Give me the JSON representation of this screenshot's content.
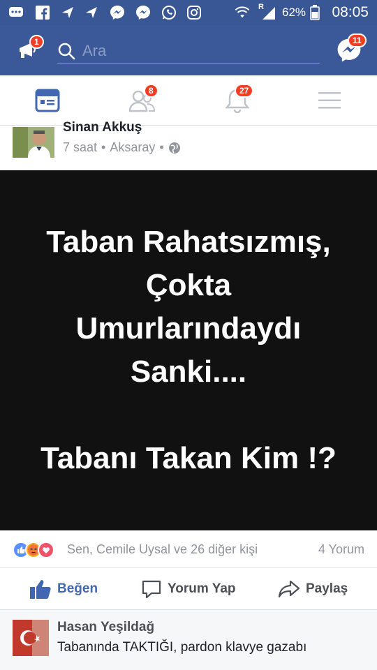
{
  "status_bar": {
    "battery": "62%",
    "time": "08:05",
    "signal_label": "R"
  },
  "header": {
    "notifications_badge": "1",
    "search_placeholder": "Ara",
    "messenger_badge": "11"
  },
  "tabs": {
    "friends_badge": "8",
    "notifications_badge": "27"
  },
  "post": {
    "author": "Sinan Akkuş",
    "time": "7 saat",
    "location": "Aksaray",
    "image_lines": [
      "Taban Rahatsızmış,",
      "Çokta",
      "Umurlarındaydı",
      "Sanki....",
      "",
      "Tabanı Takan Kim !?"
    ],
    "reactions_text": "Sen, Cemile Uysal ve 26 diğer kişi",
    "comment_count": "4 Yorum",
    "actions": {
      "like": "Beğen",
      "comment": "Yorum Yap",
      "share": "Paylaş"
    }
  },
  "comment": {
    "author": "Hasan Yeşildağ",
    "text": "Tabanında TAKTIĞI, pardon klavye gazabı"
  },
  "colors": {
    "brand": "#3b5998",
    "badge": "#f03d25",
    "like": "#4267b2"
  }
}
